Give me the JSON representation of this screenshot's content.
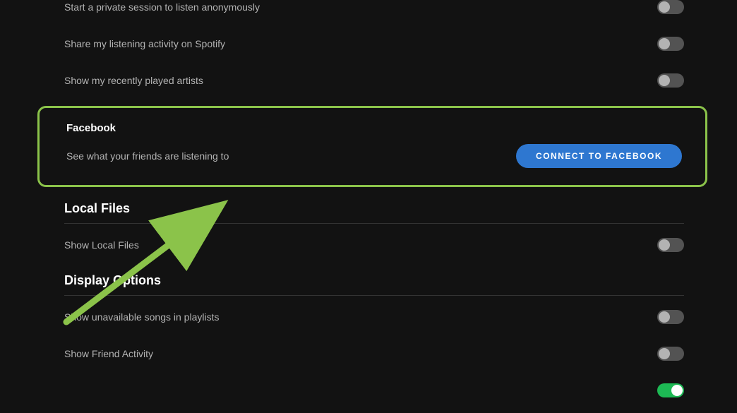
{
  "privacy": {
    "private_session": {
      "label": "Start a private session to listen anonymously",
      "enabled": false
    },
    "listening_activity": {
      "label": "Share my listening activity on Spotify",
      "enabled": false
    },
    "recently_played": {
      "label": "Show my recently played artists",
      "enabled": false
    }
  },
  "facebook": {
    "title": "Facebook",
    "description": "See what your friends are listening to",
    "button_label": "CONNECT TO FACEBOOK"
  },
  "local_files": {
    "title": "Local Files",
    "show_local": {
      "label": "Show Local Files",
      "enabled": false
    }
  },
  "display_options": {
    "title": "Display Options",
    "unavailable_songs": {
      "label": "Show unavailable songs in playlists",
      "enabled": false
    },
    "friend_activity": {
      "label": "Show Friend Activity",
      "enabled": false
    }
  },
  "annotation": {
    "highlight_color": "#8bc34a"
  }
}
